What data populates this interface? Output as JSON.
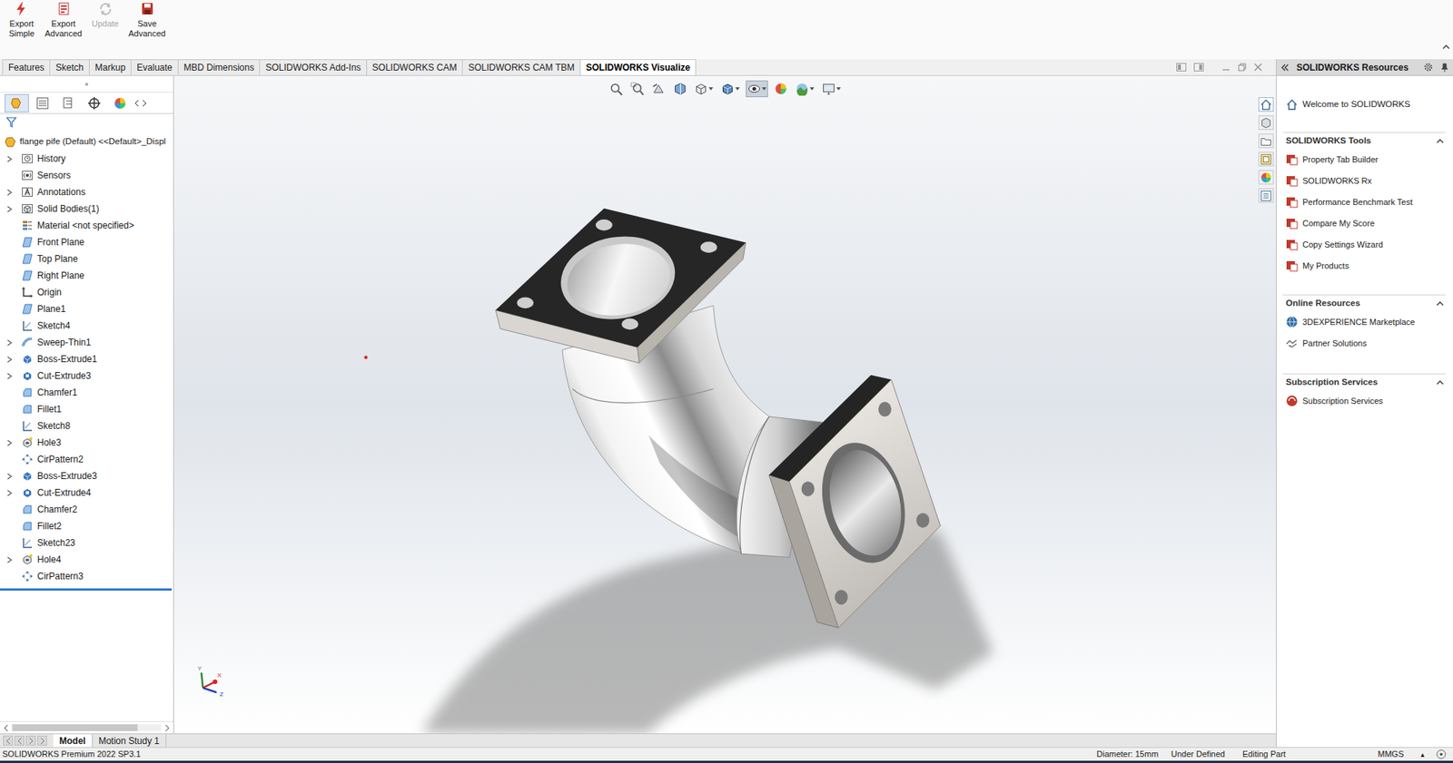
{
  "ribbon": {
    "buttons": [
      {
        "lines": [
          "Export",
          "Simple"
        ],
        "disabled": false
      },
      {
        "lines": [
          "Export",
          "Advanced"
        ],
        "disabled": false
      },
      {
        "lines": [
          "Update"
        ],
        "disabled": true
      },
      {
        "lines": [
          "Save",
          "Advanced"
        ],
        "disabled": false
      }
    ]
  },
  "tabs": [
    {
      "label": "Features",
      "selected": false
    },
    {
      "label": "Sketch",
      "selected": false
    },
    {
      "label": "Markup",
      "selected": false
    },
    {
      "label": "Evaluate",
      "selected": false
    },
    {
      "label": "MBD Dimensions",
      "selected": false
    },
    {
      "label": "SOLIDWORKS Add-Ins",
      "selected": false
    },
    {
      "label": "SOLIDWORKS CAM",
      "selected": false
    },
    {
      "label": "SOLIDWORKS CAM TBM",
      "selected": false
    },
    {
      "label": "SOLIDWORKS Visualize",
      "selected": true
    }
  ],
  "feature_tree": {
    "root": "flange pife (Default) <<Default>_Displ",
    "items": [
      {
        "label": "History",
        "expandable": true,
        "kind": "history"
      },
      {
        "label": "Sensors",
        "expandable": false,
        "kind": "sensors"
      },
      {
        "label": "Annotations",
        "expandable": true,
        "kind": "annotations"
      },
      {
        "label": "Solid Bodies(1)",
        "expandable": true,
        "kind": "bodies"
      },
      {
        "label": "Material <not specified>",
        "expandable": false,
        "kind": "material"
      },
      {
        "label": "Front Plane",
        "expandable": false,
        "kind": "plane"
      },
      {
        "label": "Top Plane",
        "expandable": false,
        "kind": "plane"
      },
      {
        "label": "Right Plane",
        "expandable": false,
        "kind": "plane"
      },
      {
        "label": "Origin",
        "expandable": false,
        "kind": "origin"
      },
      {
        "label": "Plane1",
        "expandable": false,
        "kind": "plane"
      },
      {
        "label": "Sketch4",
        "expandable": false,
        "kind": "sketch"
      },
      {
        "label": "Sweep-Thin1",
        "expandable": true,
        "kind": "sweep"
      },
      {
        "label": "Boss-Extrude1",
        "expandable": true,
        "kind": "extrude"
      },
      {
        "label": "Cut-Extrude3",
        "expandable": true,
        "kind": "cut"
      },
      {
        "label": "Chamfer1",
        "expandable": false,
        "kind": "chamfer"
      },
      {
        "label": "Fillet1",
        "expandable": false,
        "kind": "fillet"
      },
      {
        "label": "Sketch8",
        "expandable": false,
        "kind": "sketch"
      },
      {
        "label": "Hole3",
        "expandable": true,
        "kind": "hole"
      },
      {
        "label": "CirPattern2",
        "expandable": false,
        "kind": "pattern"
      },
      {
        "label": "Boss-Extrude3",
        "expandable": true,
        "kind": "extrude"
      },
      {
        "label": "Cut-Extrude4",
        "expandable": true,
        "kind": "cut"
      },
      {
        "label": "Chamfer2",
        "expandable": false,
        "kind": "chamfer"
      },
      {
        "label": "Fillet2",
        "expandable": false,
        "kind": "fillet"
      },
      {
        "label": "Sketch23",
        "expandable": false,
        "kind": "sketch"
      },
      {
        "label": "Hole4",
        "expandable": true,
        "kind": "hole"
      },
      {
        "label": "CirPattern3",
        "expandable": false,
        "kind": "pattern"
      }
    ]
  },
  "graphics": {
    "triad": {
      "x": "X",
      "y": "Y",
      "z": "Z"
    }
  },
  "bottom_tabs": [
    {
      "label": "Model",
      "selected": true
    },
    {
      "label": "Motion Study 1",
      "selected": false
    }
  ],
  "resources": {
    "title": "SOLIDWORKS Resources",
    "welcome": "Welcome to SOLIDWORKS",
    "sections": [
      {
        "title": "SOLIDWORKS Tools",
        "expanded": true,
        "items": [
          "Property Tab Builder",
          "SOLIDWORKS Rx",
          "Performance Benchmark Test",
          "Compare My Score",
          "Copy Settings Wizard",
          "My Products"
        ]
      },
      {
        "title": "Online Resources",
        "expanded": true,
        "items": [
          "3DEXPERIENCE Marketplace",
          "Partner Solutions"
        ]
      },
      {
        "title": "Subscription Services",
        "expanded": true,
        "items": [
          "Subscription Services"
        ]
      }
    ]
  },
  "status_bar": {
    "product": "SOLIDWORKS Premium 2022 SP3.1",
    "items": [
      "Diameter: 15mm",
      "Under Defined",
      "Editing Part"
    ],
    "units": "MMGS",
    "units_arrow": "▲"
  }
}
